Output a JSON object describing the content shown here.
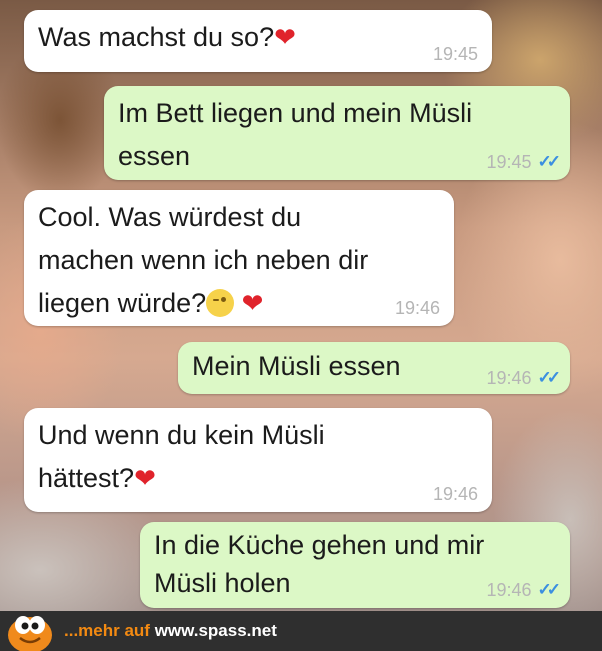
{
  "messages": [
    {
      "direction": "in",
      "text": "Was machst du so?",
      "emoji": [
        "heart"
      ],
      "time": "19:45"
    },
    {
      "direction": "out",
      "text": "Im Bett liegen und mein Müsli\nessen",
      "time": "19:45",
      "read": true
    },
    {
      "direction": "in",
      "text": "Cool. Was würdest du\nmachen wenn ich neben dir\nliegen würde?",
      "emoji": [
        "wink",
        "heart"
      ],
      "time": "19:46"
    },
    {
      "direction": "out",
      "text": "Mein Müsli essen",
      "time": "19:46",
      "read": true
    },
    {
      "direction": "in",
      "text": "Und wenn du kein Müsli\nhättest?",
      "emoji": [
        "heart"
      ],
      "time": "19:46"
    },
    {
      "direction": "out",
      "text": "In die Küche gehen und mir\nMüsli holen",
      "time": "19:46",
      "read": true
    }
  ],
  "footer": {
    "prefix": "...mehr auf ",
    "site": "www.spass.net"
  },
  "colors": {
    "incoming": "#ffffff",
    "outgoing": "#dcf8c6",
    "read_ticks": "#3b8fe0",
    "heart": "#e0232b",
    "footer_bg": "#2f2f2f",
    "footer_accent": "#f38a12"
  },
  "icons": {
    "heart": "heart-emoji",
    "wink": "winking-face-emoji",
    "read": "double-check-icon",
    "mascot": "spass-mascot-logo"
  }
}
